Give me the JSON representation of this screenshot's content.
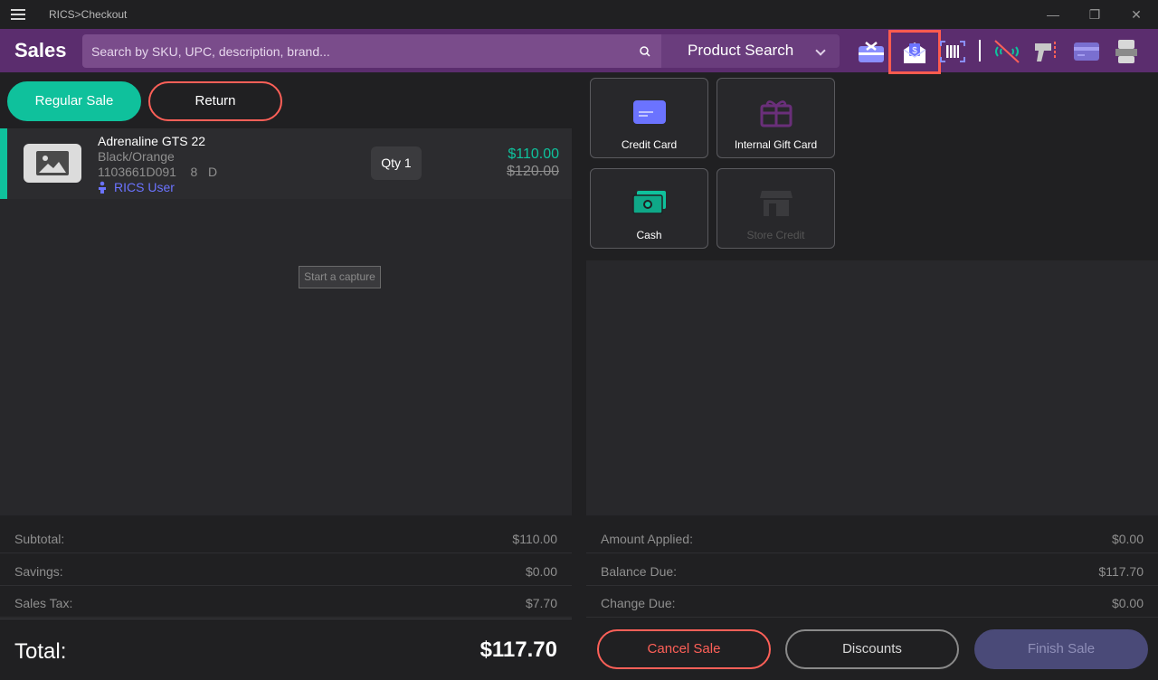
{
  "window": {
    "title": "RICS>Checkout",
    "minimize": "—",
    "restore": "❐",
    "close": "✕"
  },
  "header": {
    "title": "Sales",
    "search_placeholder": "Search by SKU, UPC, description, brand...",
    "search_mode": "Product Search",
    "icons": [
      "gift-card-icon",
      "email-receipt-icon",
      "barcode-scanner-icon",
      "no-connection-icon",
      "handheld-scanner-icon",
      "card-reader-icon",
      "receipt-printer-icon"
    ]
  },
  "sale_types": {
    "regular": "Regular Sale",
    "return": "Return"
  },
  "cart": {
    "items": [
      {
        "name": "Adrenaline GTS 22",
        "color": "Black/Orange",
        "sku": "1103661D091",
        "size": "8",
        "width": "D",
        "user": "RICS User",
        "qty_label": "Qty 1",
        "price": "$110.00",
        "original_price": "$120.00"
      }
    ]
  },
  "tooltip": "Start a capture",
  "tenders": {
    "credit_card": "Credit Card",
    "internal_gift_card": "Internal Gift Card",
    "cash": "Cash",
    "store_credit": "Store Credit"
  },
  "summary": {
    "subtotal_label": "Subtotal:",
    "subtotal": "$110.00",
    "savings_label": "Savings:",
    "savings": "$0.00",
    "tax_label": "Sales Tax:",
    "tax": "$7.70",
    "total_label": "Total:",
    "total": "$117.70"
  },
  "payment": {
    "applied_label": "Amount Applied:",
    "applied": "$0.00",
    "balance_label": "Balance Due:",
    "balance": "$117.70",
    "change_label": "Change Due:",
    "change": "$0.00"
  },
  "actions": {
    "cancel": "Cancel Sale",
    "discounts": "Discounts",
    "finish": "Finish Sale"
  },
  "colors": {
    "header": "#5b2d6e",
    "accent_green": "#0fc19c",
    "accent_red": "#ff6058",
    "accent_blue": "#6b73ff"
  }
}
